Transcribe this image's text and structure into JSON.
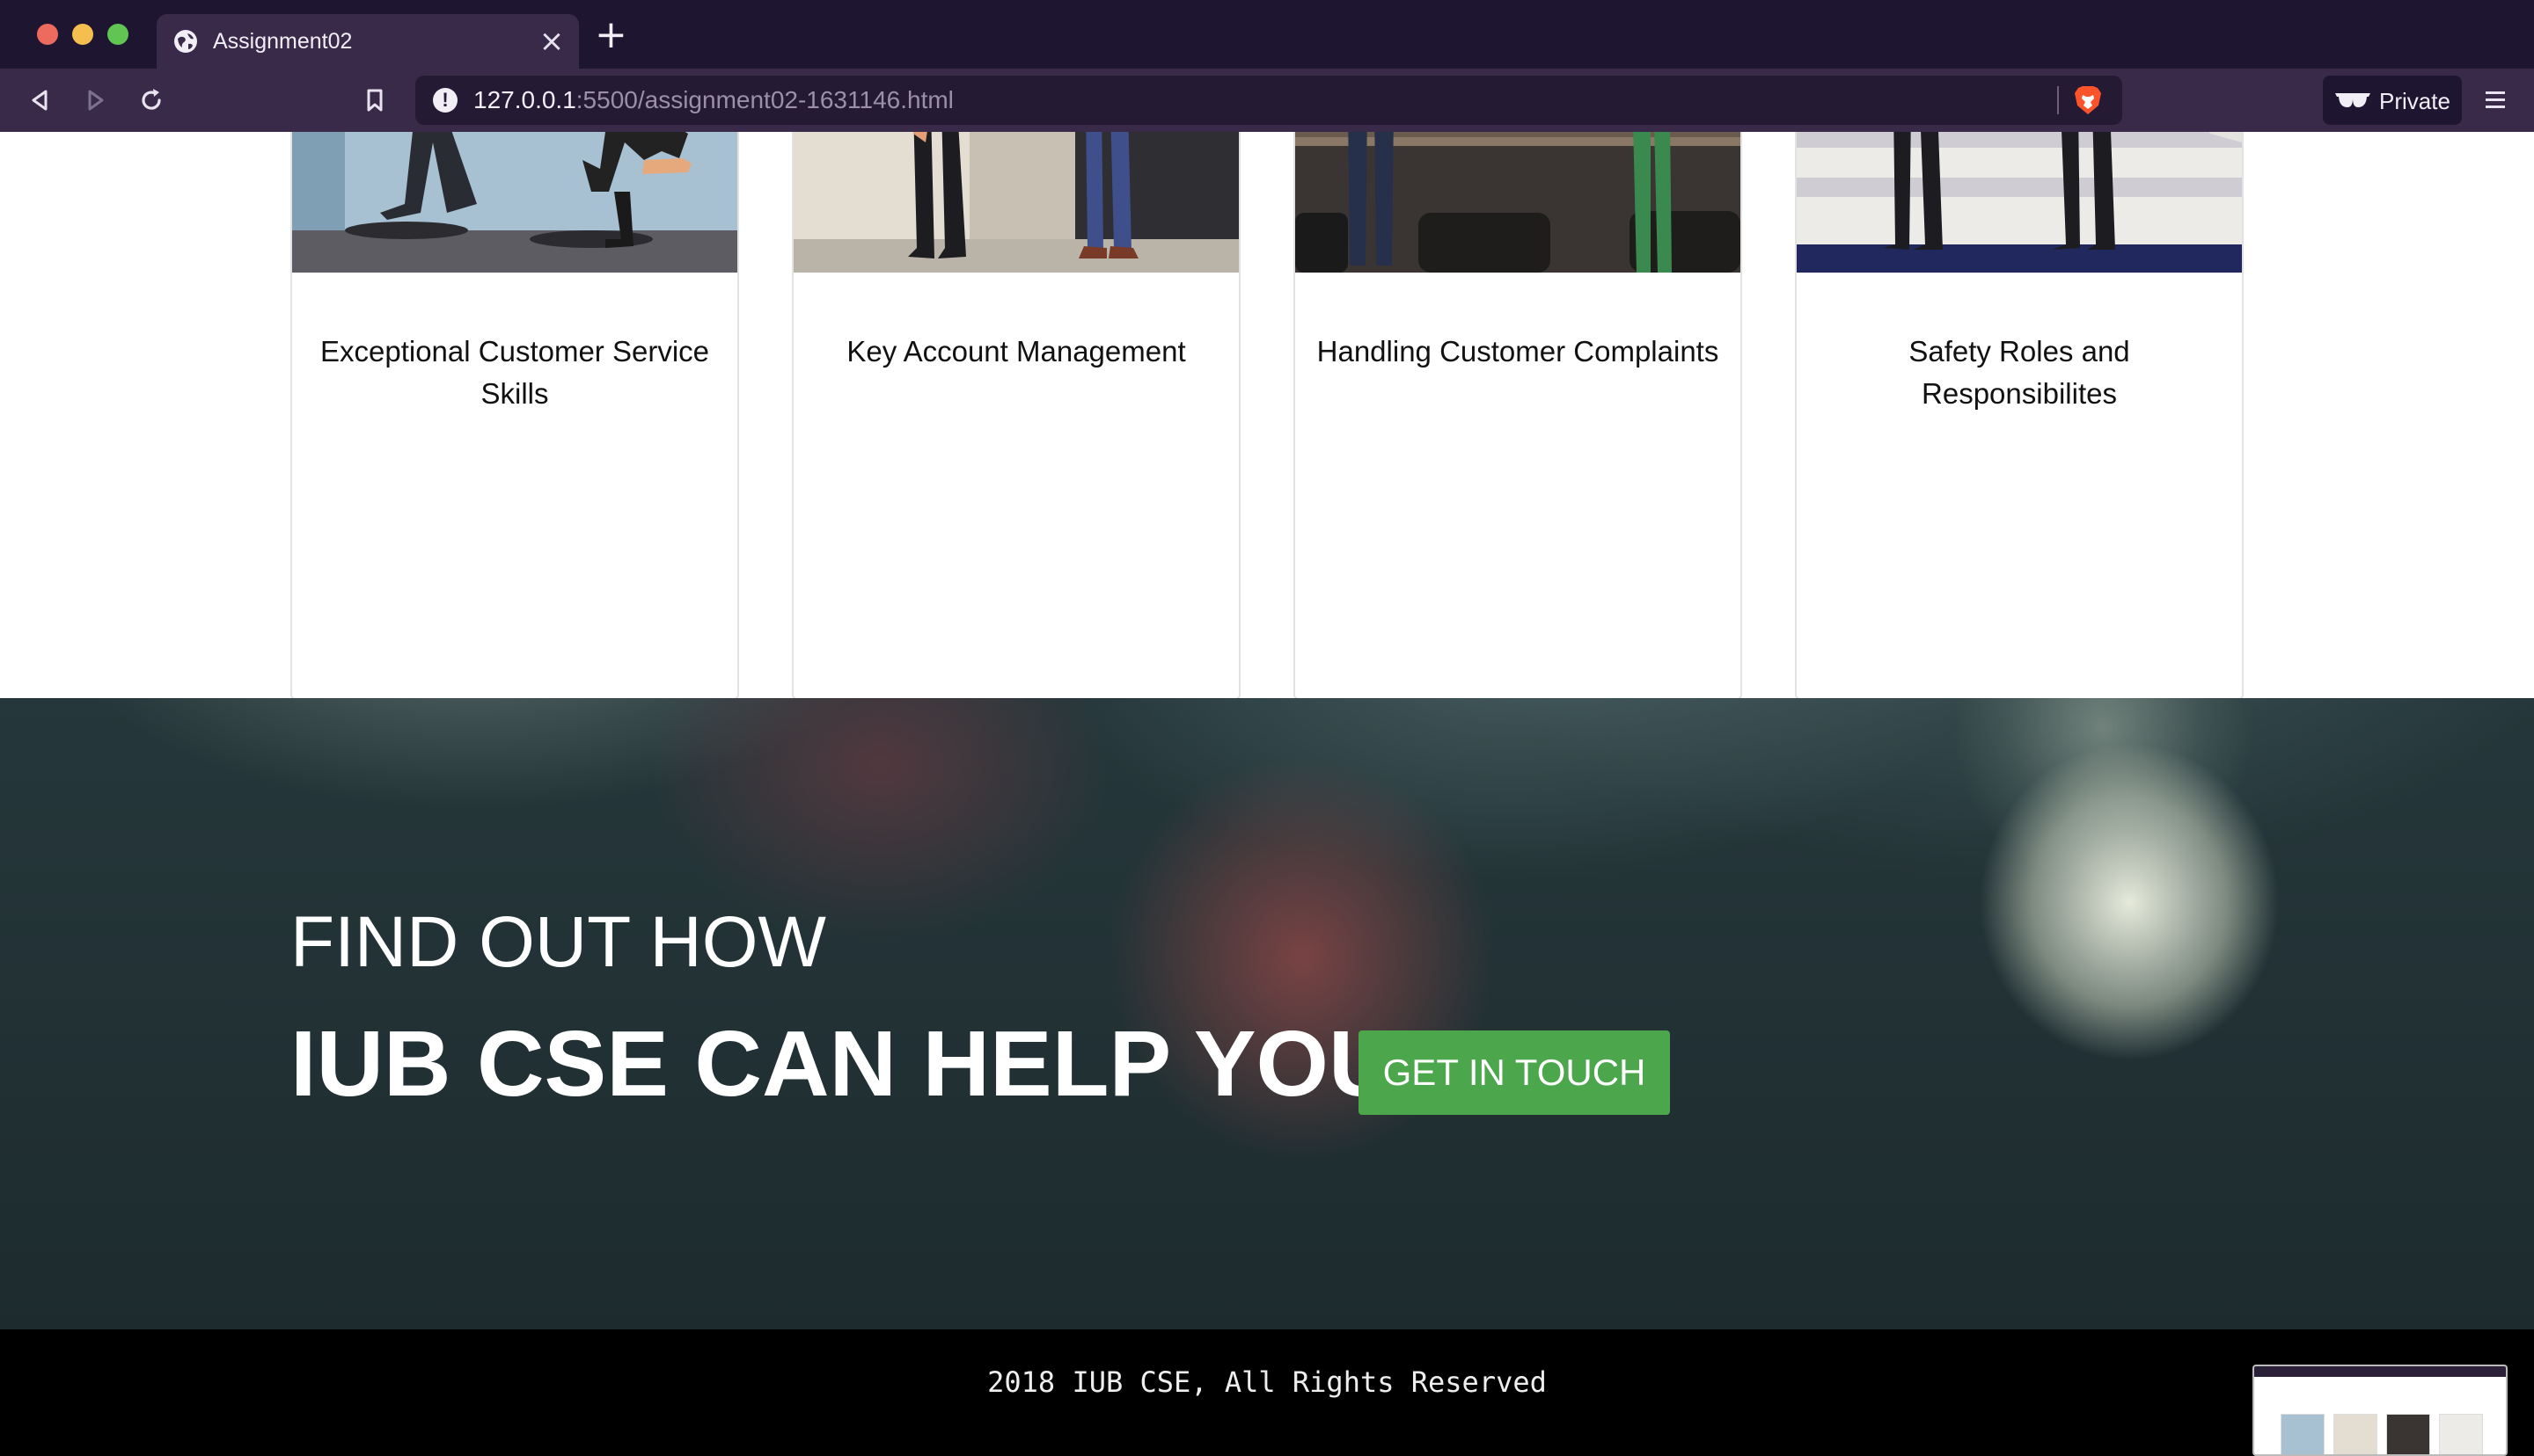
{
  "browser": {
    "tab_title": "Assignment02",
    "url_host": "127.0.0.1",
    "url_rest": ":5500/assignment02-1631146.html",
    "private_label": "Private"
  },
  "cards": [
    {
      "title": "Exceptional Customer Service Skills"
    },
    {
      "title": "Key Account Management"
    },
    {
      "title": "Handling Customer Complaints"
    },
    {
      "title": "Safety Roles and Responsibilites"
    }
  ],
  "cta": {
    "line1": "FIND OUT HOW",
    "line2": "IUB CSE CAN HELP YOU",
    "button_label": "GET IN TOUCH"
  },
  "footer": {
    "text": "2018 IUB CSE, All Rights Reserved"
  },
  "colors": {
    "titlebar": "#1e1630",
    "toolbar": "#3a2a4a",
    "cta_button": "#4ca64c",
    "footer_bg": "#000000"
  },
  "icons": [
    "globe-icon",
    "close-icon",
    "plus-icon",
    "back-icon",
    "forward-icon",
    "reload-icon",
    "bookmark-icon",
    "info-icon",
    "brave-lion-icon",
    "private-glasses-icon",
    "hamburger-menu-icon"
  ]
}
